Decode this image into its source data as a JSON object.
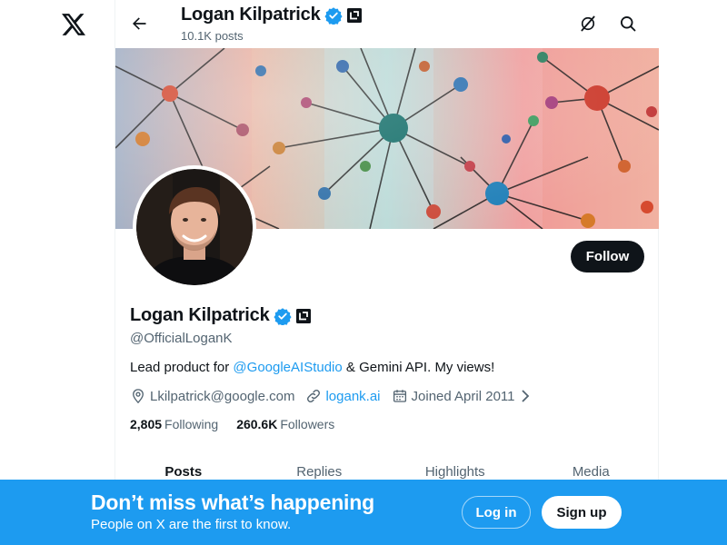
{
  "profile": {
    "name": "Logan Kilpatrick",
    "posts_count": "10.1K posts",
    "handle": "@OfficialLoganK",
    "bio_prefix": "Lead product for ",
    "bio_mention": "@GoogleAIStudio",
    "bio_suffix": " & Gemini API. My views!",
    "location": "Lkilpatrick@google.com",
    "website": "logank.ai",
    "joined": "Joined April 2011",
    "following_count": "2,805",
    "following_label": "Following",
    "followers_count": "260.6K",
    "followers_label": "Followers",
    "follow_label": "Follow"
  },
  "tabs": [
    {
      "label": "Posts",
      "active": true
    },
    {
      "label": "Replies",
      "active": false
    },
    {
      "label": "Highlights",
      "active": false
    },
    {
      "label": "Media",
      "active": false
    }
  ],
  "bottom_bar": {
    "title": "Don’t miss what’s happening",
    "subtitle": "People on X are the first to know.",
    "login_label": "Log in",
    "signup_label": "Sign up"
  },
  "icons": [
    "x-logo-icon",
    "back-arrow-icon",
    "verified-badge-icon",
    "affiliate-badge-icon",
    "grok-icon",
    "search-icon",
    "location-icon",
    "link-icon",
    "calendar-icon",
    "chevron-right-icon"
  ],
  "colors": {
    "accent": "#1d9bf0",
    "text_primary": "#0f1419",
    "text_secondary": "#536471",
    "follow_button": "#0f1419"
  }
}
